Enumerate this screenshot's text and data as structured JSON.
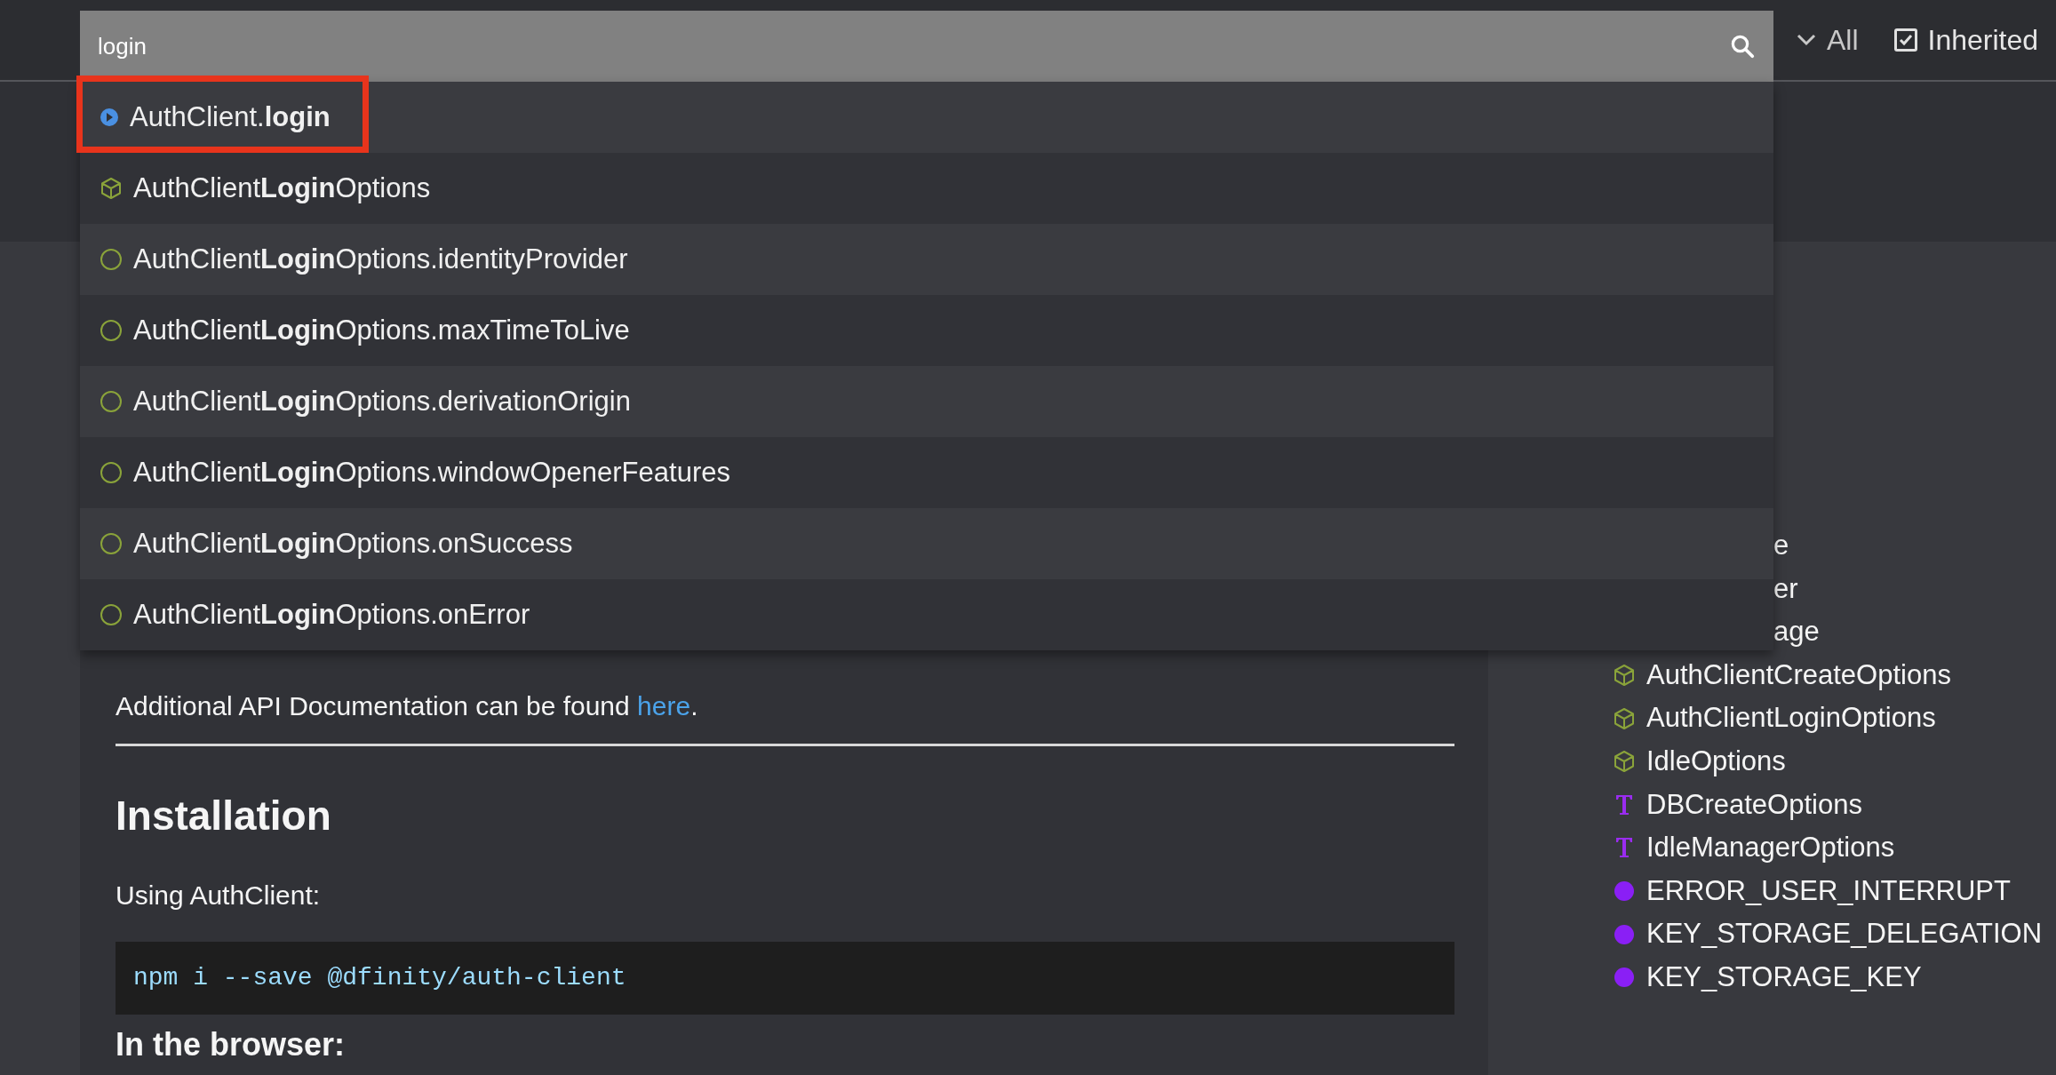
{
  "search": {
    "value": "login"
  },
  "filters": {
    "visibility": "All",
    "inherited": {
      "label": "Inherited",
      "checked": true
    }
  },
  "results": [
    {
      "kind": "method",
      "label": "AuthClient.**login**",
      "selected": true
    },
    {
      "kind": "interface",
      "label": "AuthClient**Login**Options",
      "selected": false
    },
    {
      "kind": "property",
      "label": "AuthClient**Login**Options.identityProvider",
      "selected": false
    },
    {
      "kind": "property",
      "label": "AuthClient**Login**Options.maxTimeToLive",
      "selected": false
    },
    {
      "kind": "property",
      "label": "AuthClient**Login**Options.derivationOrigin",
      "selected": false
    },
    {
      "kind": "property",
      "label": "AuthClient**Login**Options.windowOpenerFeatures",
      "selected": false
    },
    {
      "kind": "property",
      "label": "AuthClient**Login**Options.onSuccess",
      "selected": false
    },
    {
      "kind": "property",
      "label": "AuthClient**Login**Options.onError",
      "selected": false
    }
  ],
  "content": {
    "paragraph": "Additional API Documentation can be found ",
    "link": "here",
    "after_link": ".",
    "heading": "Installation",
    "usage": "Using AuthClient:",
    "code": "npm i --save @dfinity/auth-client",
    "subheading": "In the browser:"
  },
  "sidebar": {
    "items": [
      {
        "kind": "partial",
        "label": "e"
      },
      {
        "kind": "partial",
        "label": "er"
      },
      {
        "kind": "partial",
        "label": "age"
      },
      {
        "kind": "interface",
        "label": "AuthClientCreateOptions"
      },
      {
        "kind": "interface",
        "label": "AuthClientLoginOptions"
      },
      {
        "kind": "interface",
        "label": "IdleOptions"
      },
      {
        "kind": "type_alias",
        "label": "DBCreateOptions"
      },
      {
        "kind": "type_alias",
        "label": "IdleManagerOptions"
      },
      {
        "kind": "variable",
        "label": "ERROR_USER_INTERRUPT"
      },
      {
        "kind": "variable",
        "label": "KEY_STORAGE_DELEGATION"
      },
      {
        "kind": "variable",
        "label": "KEY_STORAGE_KEY"
      }
    ]
  }
}
